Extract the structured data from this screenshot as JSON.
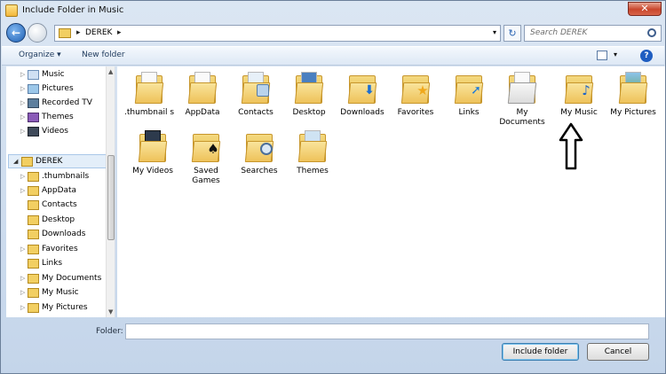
{
  "window": {
    "title": "Include Folder in Music",
    "close_glyph": "✕"
  },
  "address": {
    "path": [
      "DEREK"
    ],
    "separator": "▸",
    "search_placeholder": "Search DEREK",
    "dropdown_glyph": "▾",
    "refresh_glyph": "↻"
  },
  "toolbar": {
    "organize": "Organize ▾",
    "new_folder": "New folder",
    "help": "?",
    "view_arrow": "▾"
  },
  "nav_pane": {
    "items": [
      {
        "label": "Music",
        "icon": "music-library-icon"
      },
      {
        "label": "Pictures",
        "icon": "pictures-library-icon"
      },
      {
        "label": "Recorded TV",
        "icon": "recorded-tv-icon"
      },
      {
        "label": "Themes",
        "icon": "themes-icon"
      },
      {
        "label": "Videos",
        "icon": "videos-library-icon"
      },
      {
        "label": "DEREK",
        "icon": "user-folder-icon",
        "selected": true
      },
      {
        "label": ".thumbnails",
        "icon": "folder-icon"
      },
      {
        "label": "AppData",
        "icon": "folder-icon"
      },
      {
        "label": "Contacts",
        "icon": "contacts-folder-icon"
      },
      {
        "label": "Desktop",
        "icon": "desktop-folder-icon"
      },
      {
        "label": "Downloads",
        "icon": "downloads-folder-icon"
      },
      {
        "label": "Favorites",
        "icon": "favorites-folder-icon"
      },
      {
        "label": "Links",
        "icon": "links-folder-icon"
      },
      {
        "label": "My Documents",
        "icon": "documents-folder-icon"
      },
      {
        "label": "My Music",
        "icon": "music-folder-icon"
      },
      {
        "label": "My Pictures",
        "icon": "pictures-folder-icon"
      }
    ]
  },
  "files": [
    {
      "label": ".thumbnail s",
      "icon": "folder-icon"
    },
    {
      "label": "AppData",
      "icon": "folder-icon"
    },
    {
      "label": "Contacts",
      "icon": "contacts-folder-icon"
    },
    {
      "label": "Desktop",
      "icon": "desktop-folder-icon"
    },
    {
      "label": "Downloads",
      "icon": "downloads-folder-icon"
    },
    {
      "label": "Favorites",
      "icon": "favorites-folder-icon"
    },
    {
      "label": "Links",
      "icon": "links-folder-icon"
    },
    {
      "label": "My Documents",
      "icon": "documents-folder-icon"
    },
    {
      "label": "My Music",
      "icon": "music-folder-icon"
    },
    {
      "label": "My Pictures",
      "icon": "pictures-folder-icon"
    },
    {
      "label": "My Videos",
      "icon": "videos-folder-icon"
    },
    {
      "label": "Saved Games",
      "icon": "saved-games-folder-icon"
    },
    {
      "label": "Searches",
      "icon": "searches-folder-icon"
    },
    {
      "label": "Themes",
      "icon": "themes-folder-icon"
    }
  ],
  "footer": {
    "folder_label": "Folder:",
    "folder_value": "",
    "include_button": "Include folder",
    "cancel_button": "Cancel"
  },
  "colors": {
    "folder": "#eec25a",
    "selection": "#e3eef9",
    "accent": "#1e5dc1"
  }
}
